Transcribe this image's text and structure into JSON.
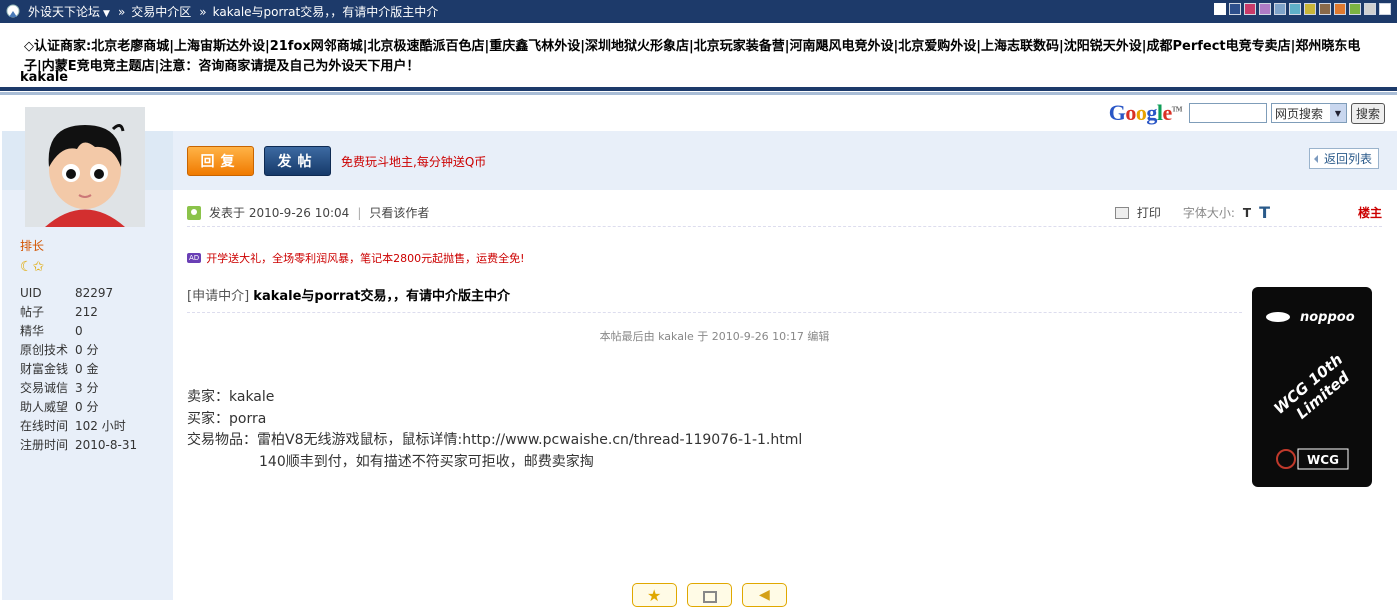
{
  "topbar": {
    "forum_name": "外设天下论坛",
    "sep1": "»",
    "section": "交易中介区",
    "sep2": "»",
    "thread_title": "kakale与porrat交易，，有请中介版主中介",
    "swatch_colors": [
      "#ffffff",
      "#2d4f8c",
      "#c83a6a",
      "#b07cc6",
      "#7fa3c9",
      "#5fb0c8",
      "#c9b63a",
      "#8a6a4a",
      "#e07a30",
      "#7cb342",
      "#d0d0d0",
      "#ffffff"
    ]
  },
  "merchants": {
    "text": "◇认证商家:北京老廖商城|上海宙斯达外设|21fox网邻商城|北京极速酷派百色店|重庆鑫飞林外设|深圳地狱火形象店|北京玩家装备营|河南飓风电竞外设|北京爱购外设|上海志联数码|沈阳锐天外设|成都Perfect电竞专卖店|郑州晓东电子|内蒙E竞电竞主题店|注意：咨询商家请提及自己为外设天下用户！"
  },
  "search": {
    "logo_g1": "G",
    "logo_o1": "o",
    "logo_o2": "o",
    "logo_g2": "g",
    "logo_l": "l",
    "logo_e": "e",
    "logo_tm": "TM",
    "input_value": "",
    "select_value": "网页搜索",
    "button_label": "搜索"
  },
  "author": {
    "name": "kakale",
    "rank": "排长",
    "stats": [
      {
        "k": "UID",
        "v": "82297"
      },
      {
        "k": "帖子",
        "v": "212"
      },
      {
        "k": "精华",
        "v": "0"
      },
      {
        "k": "原创技术",
        "v": "0 分"
      },
      {
        "k": "财富金钱",
        "v": "0 金"
      },
      {
        "k": "交易诚信",
        "v": "3 分"
      },
      {
        "k": "助人威望",
        "v": "0 分"
      },
      {
        "k": "在线时间",
        "v": "102 小时"
      },
      {
        "k": "注册时间",
        "v": "2010-8-31"
      }
    ]
  },
  "actions": {
    "reply": "回复",
    "new_post": "发帖",
    "promo": "免费玩斗地主,每分钟送Q币",
    "back_to_list": "返回列表"
  },
  "post": {
    "posted_at": "发表于 2010-9-26 10:04",
    "bar": "|",
    "only_author": "只看该作者",
    "print": "打印",
    "font_size_label": "字体大小:",
    "font_small": "T",
    "font_big": "T",
    "floor": "楼主",
    "ad_badge": "AD",
    "ad_text": "开学送大礼，全场零利润风暴，笔记本2800元起抛售，运费全免!",
    "category": "[申请中介]",
    "title": "kakale与porrat交易，，有请中介版主中介",
    "edited_note": "本帖最后由 kakale 于 2010-9-26 10:17 编辑",
    "body_lines": [
      "卖家：kakale",
      "买家：porra",
      "交易物品：雷柏V8无线游戏鼠标，鼠标详情:http://www.pcwaishe.cn/thread-119076-1-1.html",
      "140顺丰到付，如有描述不符买家可拒收，邮费卖家掏"
    ]
  },
  "side_ad": {
    "brand": "noppoo",
    "line1": "WCG 10th",
    "line2": "Limited",
    "badge": "WCG"
  }
}
